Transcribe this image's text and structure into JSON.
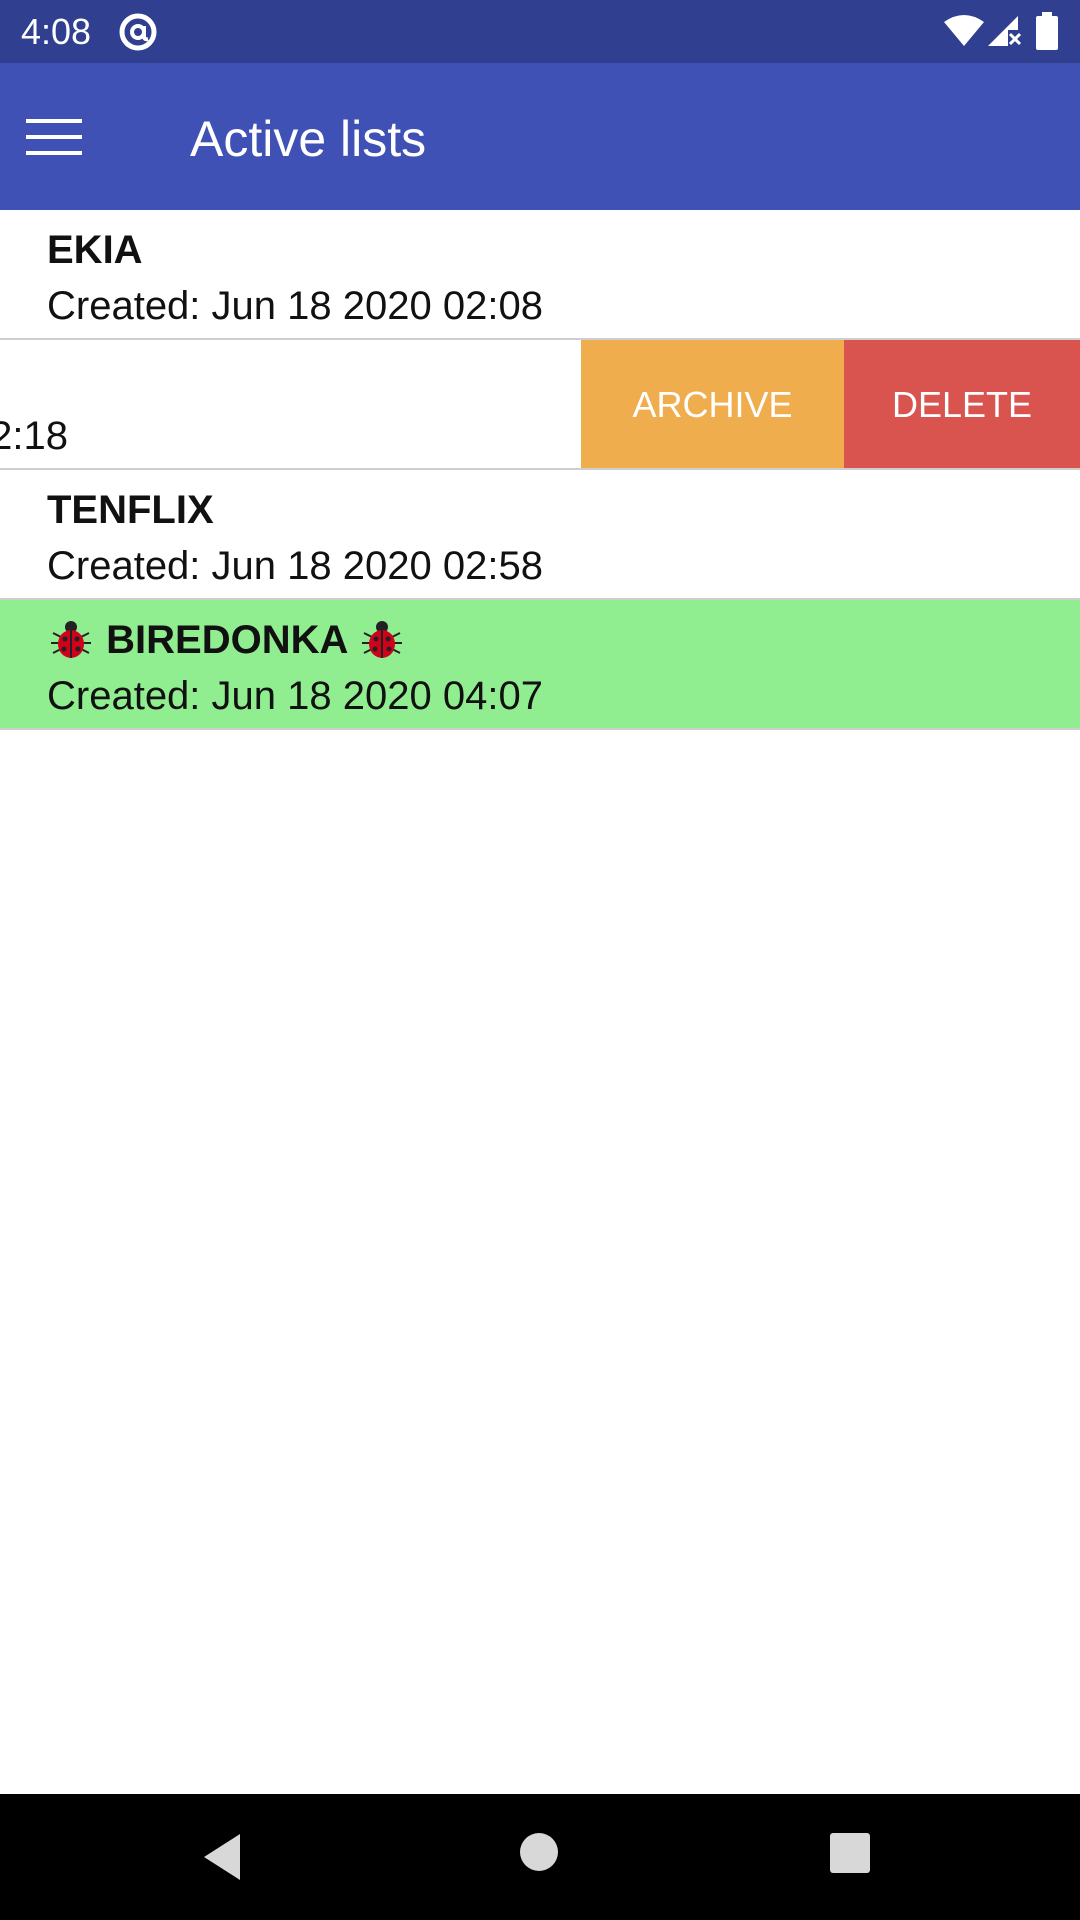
{
  "status_bar": {
    "time": "4:08",
    "icons": [
      "at-sign-icon",
      "wifi-icon",
      "signal-icon",
      "battery-icon"
    ]
  },
  "app_bar": {
    "menu_icon": "hamburger-menu-icon",
    "title": "Active lists"
  },
  "lists": [
    {
      "title": "EKIA",
      "date": "Created: Jun 18 2020 02:08"
    },
    {
      "partial_date": "2:18",
      "archive_label": "ARCHIVE",
      "delete_label": "DELETE"
    },
    {
      "title": "TENFLIX",
      "date": "Created: Jun 18 2020 02:58"
    },
    {
      "title": "BIREDONKA",
      "date": "Created: Jun 18 2020 04:07",
      "icon": "ladybug-icon",
      "highlight_color": "#90EE90"
    }
  ],
  "nav_bar": {
    "icons": [
      "back-icon",
      "home-icon",
      "recents-icon"
    ]
  },
  "colors": {
    "status_bar": "#303F90",
    "app_bar": "#3F51B5",
    "archive": "#F0AD4E",
    "delete": "#D9534F",
    "highlight": "#90EE90"
  }
}
